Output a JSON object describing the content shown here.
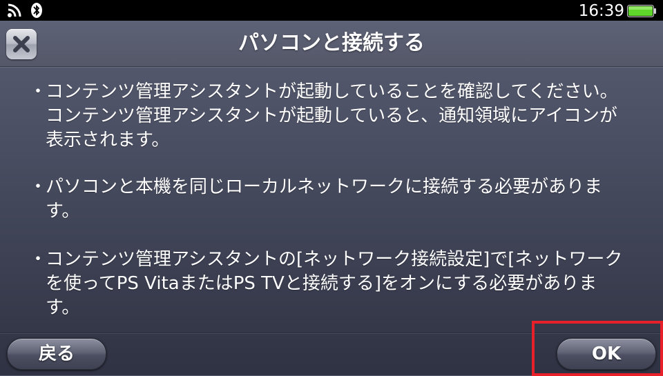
{
  "status_bar": {
    "time": "16:39",
    "icons": [
      "wifi-icon",
      "bluetooth-icon",
      "battery-icon"
    ],
    "battery_color": "#5fd62a"
  },
  "header": {
    "title": "パソコンと接続する",
    "close_icon": "close-icon"
  },
  "content": {
    "bullet": "・",
    "items": [
      "コンテンツ管理アシスタントが起動していることを確認してください。コンテンツ管理アシスタントが起動していると、通知領域にアイコンが表示されます。",
      "パソコンと本機を同じローカルネットワークに接続する必要があります。",
      "コンテンツ管理アシスタントの[ネットワーク接続設定]で[ネットワークを使ってPS VitaまたはPS TVと接続する]をオンにする必要があります。"
    ]
  },
  "footer": {
    "back_label": "戻る",
    "ok_label": "OK",
    "highlight_color": "#e8202a"
  }
}
